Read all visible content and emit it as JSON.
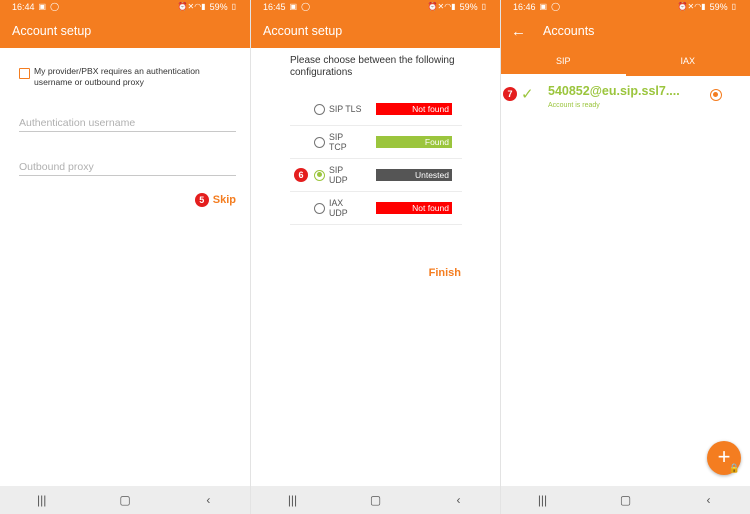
{
  "panel1": {
    "status": {
      "time": "16:44",
      "battery": "59%"
    },
    "title": "Account setup",
    "checkbox_label": "My provider/PBX requires an authentication username or outbound proxy",
    "auth_placeholder": "Authentication username",
    "proxy_placeholder": "Outbound proxy",
    "step": "5",
    "skip_label": "Skip"
  },
  "panel2": {
    "status": {
      "time": "16:45",
      "battery": "59%"
    },
    "title": "Account setup",
    "instruction": "Please choose between the following configurations",
    "configs": [
      {
        "line1": "SIP TLS",
        "line2": "",
        "status": "Not found",
        "selected": false
      },
      {
        "line1": "SIP",
        "line2": "TCP",
        "status": "Found",
        "selected": false
      },
      {
        "line1": "SIP",
        "line2": "UDP",
        "status": "Untested",
        "selected": true
      },
      {
        "line1": "IAX",
        "line2": "UDP",
        "status": "Not found",
        "selected": false
      }
    ],
    "step": "6",
    "finish_label": "Finish"
  },
  "panel3": {
    "status": {
      "time": "16:46",
      "battery": "59%"
    },
    "title": "Accounts",
    "tabs": [
      "SIP",
      "IAX"
    ],
    "account": {
      "name": "540852@eu.sip.ssl7....",
      "status": "Account is ready"
    },
    "step": "7"
  },
  "colors": {
    "accent": "#f47d20",
    "green": "#9bc53d",
    "red": "#ff0000",
    "grey": "#555555",
    "step": "#e41e1e"
  },
  "icons": {
    "nav": [
      "recents-icon",
      "home-icon",
      "back-icon"
    ]
  }
}
